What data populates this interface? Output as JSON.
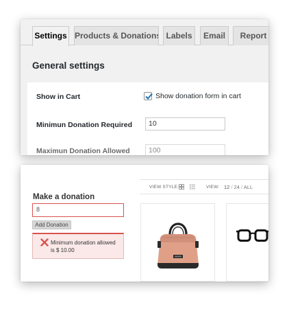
{
  "settings_panel": {
    "tabs": [
      {
        "label": "Settings",
        "active": true
      },
      {
        "label": "Products & Donations",
        "active": false
      },
      {
        "label": "Labels",
        "active": false
      },
      {
        "label": "Email",
        "active": false
      },
      {
        "label": "Report",
        "active": false
      }
    ],
    "section_title": "General settings",
    "show_in_cart": {
      "label": "Show in Cart",
      "checkbox_label": "Show donation form in cart",
      "checked": true
    },
    "min_donation": {
      "label": "Minimun Donation Required",
      "value": "10"
    },
    "max_donation": {
      "label": "Maximun Donation Allowed",
      "value": "100"
    }
  },
  "storefront": {
    "donation_form": {
      "title": "Make a donation",
      "input_value": "8",
      "button_label": "Add Donation",
      "error_message": "Minimum donation allowed is $ 10.00"
    },
    "toolbar": {
      "view_style_label": "VIEW STYLE:",
      "view_label": "VIEW:",
      "view_options": [
        "12",
        "24",
        "ALL"
      ],
      "selected_view": "12"
    },
    "products": [
      {
        "image": "handbag-image"
      },
      {
        "image": "eyeglasses-image"
      }
    ]
  },
  "colors": {
    "error_red": "#d9534f",
    "error_bg": "#fbe9e9",
    "checkbox_check": "#2271b1",
    "panel_bg": "#f1f1f1"
  },
  "icons": [
    "check-icon",
    "error-x-icon",
    "grid-view-icon",
    "list-view-icon"
  ]
}
